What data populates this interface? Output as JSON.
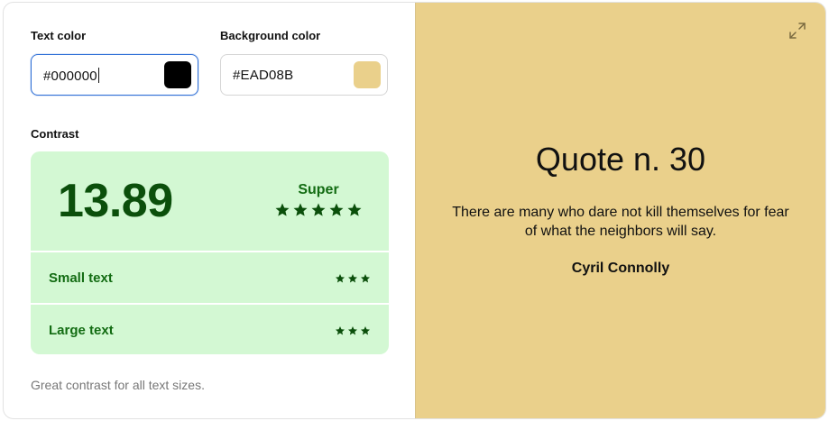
{
  "text_color": {
    "label": "Text color",
    "value": "#000000",
    "swatch": "#000000"
  },
  "background_color": {
    "label": "Background color",
    "value": "#EAD08B",
    "swatch": "#EAD08B"
  },
  "contrast": {
    "label": "Contrast",
    "ratio": "13.89",
    "grade": "Super",
    "grade_stars": 5,
    "rows": [
      {
        "label": "Small text",
        "stars": 3
      },
      {
        "label": "Large text",
        "stars": 3
      }
    ],
    "note": "Great contrast for all text sizes."
  },
  "preview": {
    "icon": "expand-icon",
    "title": "Quote n. 30",
    "text": "There are many who dare not kill themselves for fear of what the neighbors will say.",
    "author": "Cyril Connolly"
  },
  "colors": {
    "panel_bg": "#d3f8d3",
    "rating_text": "#0b4f0b",
    "focus_ring": "#2f6fd6"
  }
}
